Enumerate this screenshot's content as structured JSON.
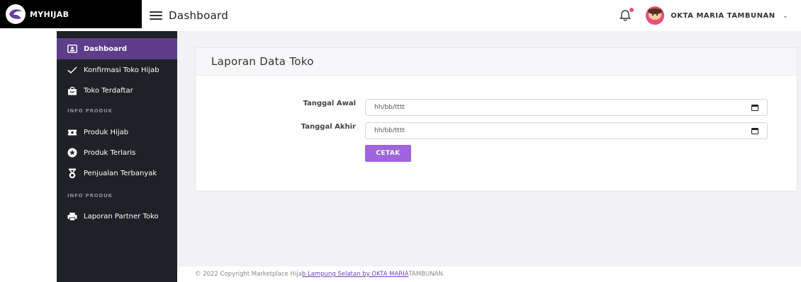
{
  "brand": {
    "name": "MYHIJAB"
  },
  "header": {
    "title": "Dashboard",
    "user_name": "OKTA MARIA TAMBUNAN",
    "notification_badge_color": "#ec4d8f"
  },
  "sidebar": {
    "items": [
      {
        "label": "Dashboard",
        "icon": "id-card-icon",
        "active": true
      },
      {
        "label": "Konfirmasi Toko Hijab",
        "icon": "check-icon",
        "active": false
      },
      {
        "label": "Toko Terdaftar",
        "icon": "shopping-bag-icon",
        "active": false
      }
    ],
    "heading_1": "INFO PRODUK",
    "items_2": [
      {
        "label": "Produk Hijab",
        "icon": "ticket-icon"
      },
      {
        "label": "Produk Terlaris",
        "icon": "star-icon"
      },
      {
        "label": "Penjualan Terbanyak",
        "icon": "medal-icon"
      }
    ],
    "heading_2": "INFO PRODUK",
    "items_3": [
      {
        "label": "Laporan Partner Toko",
        "icon": "printer-icon"
      }
    ]
  },
  "main": {
    "card_title": "Laporan Data Toko",
    "form": {
      "start_label": "Tanggal Awal",
      "start_placeholder": "hh/bb/tttt",
      "end_label": "Tanggal Akhir",
      "end_placeholder": "hh/bb/tttt",
      "submit_label": "CETAK"
    }
  },
  "footer": {
    "prefix": "© 2022 Copyright Marketplace Hija",
    "link_1": "b Lampung Selatan by OKTA MARIA",
    "suffix": " TAMBUNAN."
  },
  "colors": {
    "sidebar_bg": "#1e2125",
    "active_item_bg": "#5e3e8a",
    "accent_button": "#a065dd"
  }
}
